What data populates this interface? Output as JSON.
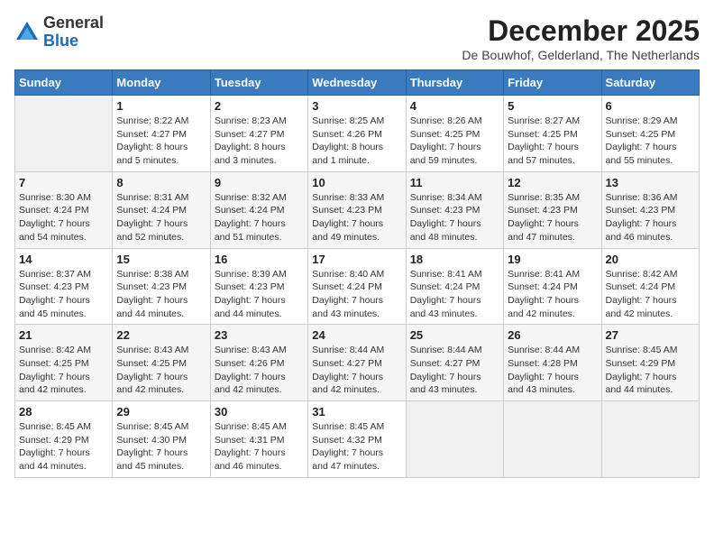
{
  "logo": {
    "general": "General",
    "blue": "Blue"
  },
  "header": {
    "month": "December 2025",
    "location": "De Bouwhof, Gelderland, The Netherlands"
  },
  "days_of_week": [
    "Sunday",
    "Monday",
    "Tuesday",
    "Wednesday",
    "Thursday",
    "Friday",
    "Saturday"
  ],
  "weeks": [
    [
      {
        "day": "",
        "info": ""
      },
      {
        "day": "1",
        "info": "Sunrise: 8:22 AM\nSunset: 4:27 PM\nDaylight: 8 hours\nand 5 minutes."
      },
      {
        "day": "2",
        "info": "Sunrise: 8:23 AM\nSunset: 4:27 PM\nDaylight: 8 hours\nand 3 minutes."
      },
      {
        "day": "3",
        "info": "Sunrise: 8:25 AM\nSunset: 4:26 PM\nDaylight: 8 hours\nand 1 minute."
      },
      {
        "day": "4",
        "info": "Sunrise: 8:26 AM\nSunset: 4:25 PM\nDaylight: 7 hours\nand 59 minutes."
      },
      {
        "day": "5",
        "info": "Sunrise: 8:27 AM\nSunset: 4:25 PM\nDaylight: 7 hours\nand 57 minutes."
      },
      {
        "day": "6",
        "info": "Sunrise: 8:29 AM\nSunset: 4:25 PM\nDaylight: 7 hours\nand 55 minutes."
      }
    ],
    [
      {
        "day": "7",
        "info": "Sunrise: 8:30 AM\nSunset: 4:24 PM\nDaylight: 7 hours\nand 54 minutes."
      },
      {
        "day": "8",
        "info": "Sunrise: 8:31 AM\nSunset: 4:24 PM\nDaylight: 7 hours\nand 52 minutes."
      },
      {
        "day": "9",
        "info": "Sunrise: 8:32 AM\nSunset: 4:24 PM\nDaylight: 7 hours\nand 51 minutes."
      },
      {
        "day": "10",
        "info": "Sunrise: 8:33 AM\nSunset: 4:23 PM\nDaylight: 7 hours\nand 49 minutes."
      },
      {
        "day": "11",
        "info": "Sunrise: 8:34 AM\nSunset: 4:23 PM\nDaylight: 7 hours\nand 48 minutes."
      },
      {
        "day": "12",
        "info": "Sunrise: 8:35 AM\nSunset: 4:23 PM\nDaylight: 7 hours\nand 47 minutes."
      },
      {
        "day": "13",
        "info": "Sunrise: 8:36 AM\nSunset: 4:23 PM\nDaylight: 7 hours\nand 46 minutes."
      }
    ],
    [
      {
        "day": "14",
        "info": "Sunrise: 8:37 AM\nSunset: 4:23 PM\nDaylight: 7 hours\nand 45 minutes."
      },
      {
        "day": "15",
        "info": "Sunrise: 8:38 AM\nSunset: 4:23 PM\nDaylight: 7 hours\nand 44 minutes."
      },
      {
        "day": "16",
        "info": "Sunrise: 8:39 AM\nSunset: 4:23 PM\nDaylight: 7 hours\nand 44 minutes."
      },
      {
        "day": "17",
        "info": "Sunrise: 8:40 AM\nSunset: 4:24 PM\nDaylight: 7 hours\nand 43 minutes."
      },
      {
        "day": "18",
        "info": "Sunrise: 8:41 AM\nSunset: 4:24 PM\nDaylight: 7 hours\nand 43 minutes."
      },
      {
        "day": "19",
        "info": "Sunrise: 8:41 AM\nSunset: 4:24 PM\nDaylight: 7 hours\nand 42 minutes."
      },
      {
        "day": "20",
        "info": "Sunrise: 8:42 AM\nSunset: 4:24 PM\nDaylight: 7 hours\nand 42 minutes."
      }
    ],
    [
      {
        "day": "21",
        "info": "Sunrise: 8:42 AM\nSunset: 4:25 PM\nDaylight: 7 hours\nand 42 minutes."
      },
      {
        "day": "22",
        "info": "Sunrise: 8:43 AM\nSunset: 4:25 PM\nDaylight: 7 hours\nand 42 minutes."
      },
      {
        "day": "23",
        "info": "Sunrise: 8:43 AM\nSunset: 4:26 PM\nDaylight: 7 hours\nand 42 minutes."
      },
      {
        "day": "24",
        "info": "Sunrise: 8:44 AM\nSunset: 4:27 PM\nDaylight: 7 hours\nand 42 minutes."
      },
      {
        "day": "25",
        "info": "Sunrise: 8:44 AM\nSunset: 4:27 PM\nDaylight: 7 hours\nand 43 minutes."
      },
      {
        "day": "26",
        "info": "Sunrise: 8:44 AM\nSunset: 4:28 PM\nDaylight: 7 hours\nand 43 minutes."
      },
      {
        "day": "27",
        "info": "Sunrise: 8:45 AM\nSunset: 4:29 PM\nDaylight: 7 hours\nand 44 minutes."
      }
    ],
    [
      {
        "day": "28",
        "info": "Sunrise: 8:45 AM\nSunset: 4:29 PM\nDaylight: 7 hours\nand 44 minutes."
      },
      {
        "day": "29",
        "info": "Sunrise: 8:45 AM\nSunset: 4:30 PM\nDaylight: 7 hours\nand 45 minutes."
      },
      {
        "day": "30",
        "info": "Sunrise: 8:45 AM\nSunset: 4:31 PM\nDaylight: 7 hours\nand 46 minutes."
      },
      {
        "day": "31",
        "info": "Sunrise: 8:45 AM\nSunset: 4:32 PM\nDaylight: 7 hours\nand 47 minutes."
      },
      {
        "day": "",
        "info": ""
      },
      {
        "day": "",
        "info": ""
      },
      {
        "day": "",
        "info": ""
      }
    ]
  ]
}
